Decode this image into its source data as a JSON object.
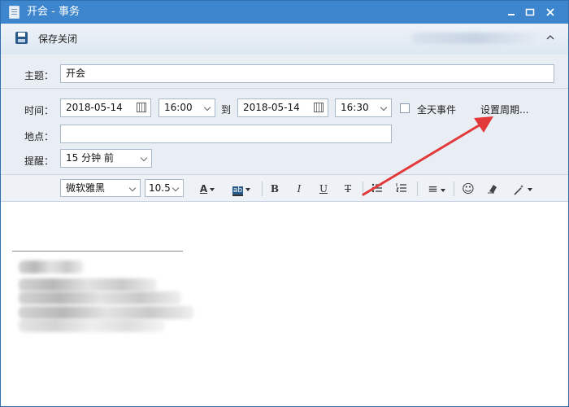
{
  "window": {
    "title": "开会 - 事务"
  },
  "toolbar": {
    "save_label": "保存关闭"
  },
  "form": {
    "subject_label": "主题：",
    "subject_value": "开会",
    "time_label": "时间：",
    "start_date": "2018-05-14",
    "start_time": "16:00",
    "to_label": "到",
    "end_date": "2018-05-14",
    "end_time": "16:30",
    "all_day_label": "全天事件",
    "all_day_checked": false,
    "recurrence_label": "设置周期...",
    "location_label": "地点：",
    "location_value": "",
    "reminder_label": "提醒：",
    "reminder_value": "15 分钟 前"
  },
  "format_toolbar": {
    "font_family": "微软雅黑",
    "font_size": "10.5",
    "font_color_glyph": "A",
    "highlight_glyph": "ab",
    "bold_glyph": "B",
    "italic_glyph": "I",
    "underline_glyph": "U",
    "strike_glyph": "T",
    "align_glyph": "≡",
    "emoji_glyph": "☺",
    "icons": [
      "font-color-icon",
      "highlight-icon",
      "bold-icon",
      "italic-icon",
      "underline-icon",
      "strikethrough-icon",
      "bullet-list-icon",
      "numbered-list-icon",
      "align-icon",
      "emoji-icon",
      "clear-format-icon",
      "magic-wand-icon"
    ]
  },
  "colors": {
    "titlebar": "#3d86cd",
    "form_bg": "#e9eef4",
    "annotation_arrow": "#e23a3a"
  }
}
